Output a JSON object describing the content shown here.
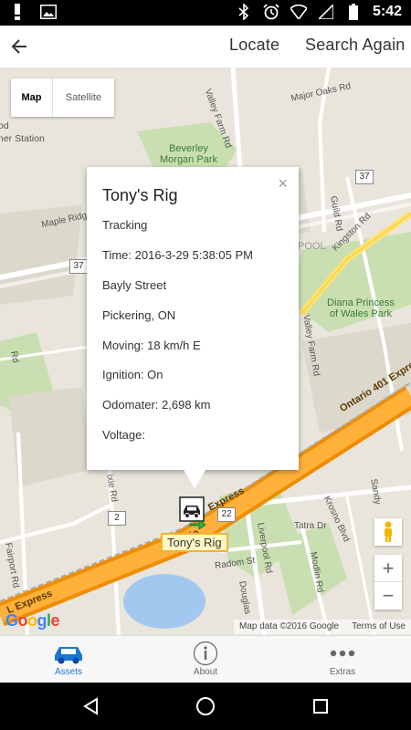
{
  "status_bar": {
    "time": "5:42",
    "left_icons": [
      "alert-icon",
      "image-icon"
    ],
    "right_icons": [
      "bluetooth-icon",
      "alarm-icon",
      "wifi-icon",
      "signal-icon",
      "battery-icon"
    ]
  },
  "app_bar": {
    "back_icon": "back-arrow-icon",
    "locate_label": "Locate",
    "search_again_label": "Search Again"
  },
  "map": {
    "type_control": {
      "map_label": "Map",
      "satellite_label": "Satellite",
      "selected": "Map"
    },
    "labels": {
      "station": "ner Station",
      "od": "od",
      "valley_farm_rd_top": "Valley Farm Rd",
      "major_oaks_rd": "Major Oaks Rd",
      "beverley_morgan_park": "Beverley\nMorgan Park",
      "maple_ridge": "Maple Ridg",
      "guild_rd": "Guild Rd",
      "kingston_rd": "Kingston Rd",
      "pool": "POOL",
      "diana_park": "Diana Princess\nof Wales Park",
      "valley_farm_rd_mid": "Valley Farm Rd",
      "ontario_401_upper": "Ontario 401 Expre",
      "ontario_401_lower": "Ontario",
      "express": "Express",
      "krosno_blvd": "Krosno Blvd",
      "sandy": "Sandy",
      "tatra_dr": "Tatra Dr",
      "radom_st": "Radom St",
      "liverpool_rd": "Liverpool Rd",
      "modlin_rd": "Modlin Rd",
      "douglas": "Douglas",
      "fairport_rd": "Fairport Rd",
      "ixie_rd": "ixie Rd",
      "rd_left": "Rd",
      "l_express": "L Express"
    },
    "shields": [
      "37",
      "37",
      "2",
      "22"
    ],
    "google_logo": "Google",
    "attribution": "Map data ©2016 Google",
    "terms": "Terms of Use",
    "zoom_in": "+",
    "zoom_out": "−",
    "info_window": {
      "title": "Tony's Rig",
      "lines": [
        "Tracking",
        "Time: 2016-3-29 5:38:05 PM",
        "Bayly Street",
        "Pickering, ON",
        "Moving: 18 km/h E",
        "Ignition: On",
        "Odomater: 2,698 km",
        "Voltage:"
      ],
      "close": "×"
    },
    "marker_label": "Tony's Rig"
  },
  "bottom_nav": {
    "items": [
      {
        "label": "Assets",
        "icon": "car-icon",
        "active": true
      },
      {
        "label": "About",
        "icon": "info-icon",
        "active": false
      },
      {
        "label": "Extras",
        "icon": "more-icon",
        "active": false
      }
    ]
  },
  "system_nav": [
    "back-triangle-icon",
    "home-circle-icon",
    "recents-square-icon"
  ],
  "colors": {
    "accent": "#1976d2",
    "highway": "#f5a623",
    "map_bg": "#e9e5dc",
    "park": "#c9dfb1"
  }
}
